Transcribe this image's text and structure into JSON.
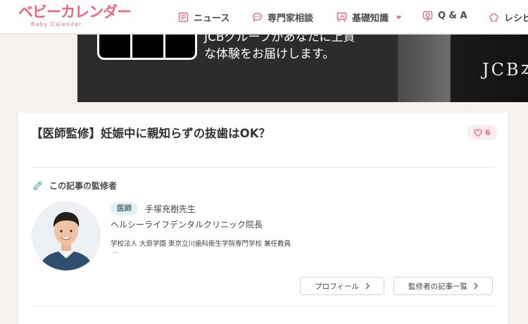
{
  "header": {
    "logo_text": "ベビーカレンダー",
    "logo_sub": "Baby Calendar",
    "nav": [
      {
        "label": "ニュース",
        "icon": "newspaper-icon"
      },
      {
        "label": "専門家相談",
        "icon": "chat-bubble-icon"
      },
      {
        "label": "基礎知識",
        "icon": "easel-chart-icon",
        "has_dropdown": true
      },
      {
        "label": "Q & A",
        "icon": "qa-bubble-icon"
      },
      {
        "label": "レシピ",
        "icon": "chef-hat-icon"
      }
    ]
  },
  "banner": {
    "line1": "JCBグループがあなたに上質",
    "line2": "な体験をお届けします。",
    "photo_sign": "JCB本"
  },
  "article": {
    "title": "【医師監修】妊娠中に親知らずの抜歯はOK？",
    "likes": "6"
  },
  "supervisor": {
    "heading": "この記事の監修者",
    "badge": "医師",
    "name": "手塚充樹先生",
    "title": "ヘルシーライフデンタルクリニック院長",
    "description": "学校法人 大原学園 東京立川歯科衛生学院専門学校 兼任教員",
    "more": "…",
    "profile_button": "プロフィール",
    "articles_button": "監修者の記事一覧"
  },
  "colors": {
    "brand_pink": "#e8697e",
    "page_bg": "#f4f1ef",
    "badge_bg": "#e4f1f4",
    "like_bg": "#fbecee"
  }
}
